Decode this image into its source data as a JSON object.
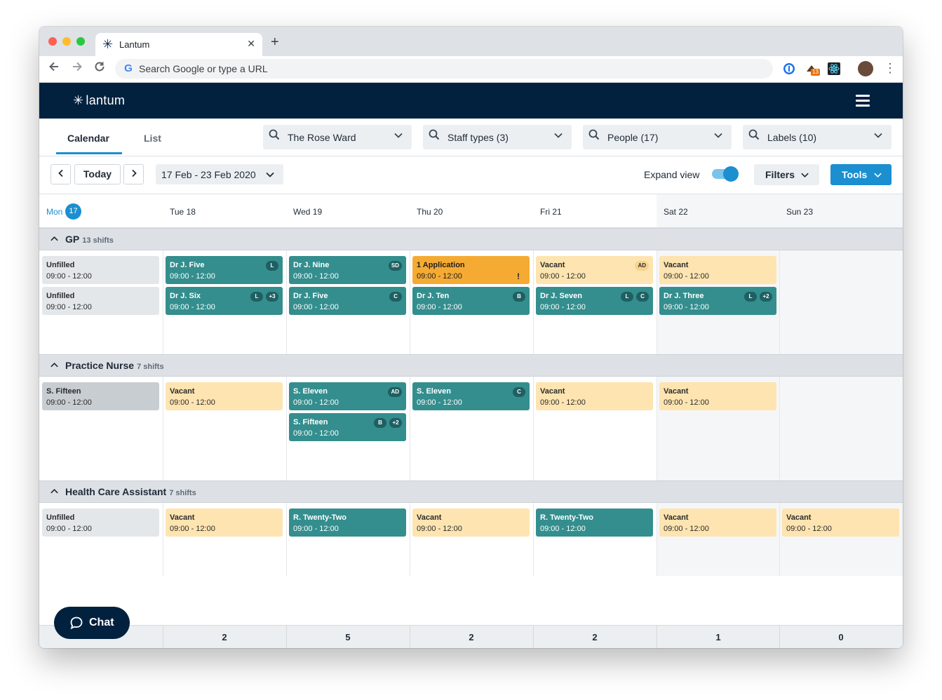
{
  "browser": {
    "tab_title": "Lantum",
    "omnibox_placeholder": "Search Google or type a URL",
    "extension_badge": "13"
  },
  "app": {
    "logo_text": "lantum",
    "view_tabs": [
      "Calendar",
      "List"
    ],
    "active_view": "Calendar",
    "filters": [
      {
        "label": "The Rose Ward"
      },
      {
        "label": "Staff types (3)"
      },
      {
        "label": "People (17)"
      },
      {
        "label": "Labels (10)"
      }
    ],
    "date_controls": {
      "today_label": "Today",
      "range_label": "17 Feb - 23 Feb 2020",
      "expand_view_label": "Expand view",
      "expand_view_on": true,
      "filters_label": "Filters",
      "tools_label": "Tools"
    },
    "days": [
      {
        "label": "Mon",
        "badge": "17",
        "today": true
      },
      {
        "label": "Tue 18"
      },
      {
        "label": "Wed 19"
      },
      {
        "label": "Thu 20"
      },
      {
        "label": "Fri 21"
      },
      {
        "label": "Sat 22",
        "weekend": true
      },
      {
        "label": "Sun 23",
        "weekend": true
      }
    ],
    "sections": [
      {
        "title": "GP",
        "count": "13 shifts",
        "days": [
          [
            {
              "name": "Unfilled",
              "time": "09:00 - 12:00",
              "style": "unfilled",
              "tags": []
            },
            {
              "name": "Unfilled",
              "time": "09:00 - 12:00",
              "style": "unfilled",
              "tags": []
            }
          ],
          [
            {
              "name": "Dr J. Five",
              "time": "09:00 - 12:00",
              "style": "teal",
              "tags": [
                "L"
              ]
            },
            {
              "name": "Dr J. Six",
              "time": "09:00 - 12:00",
              "style": "teal",
              "tags": [
                "L",
                "+3"
              ]
            }
          ],
          [
            {
              "name": "Dr J. Nine",
              "time": "09:00 - 12:00",
              "style": "teal",
              "tags": [
                "SD"
              ]
            },
            {
              "name": "Dr J. Five",
              "time": "09:00 - 12:00",
              "style": "teal",
              "tags": [
                "C"
              ]
            }
          ],
          [
            {
              "name": "1 Application",
              "time": "09:00 - 12:00",
              "style": "application",
              "tags": [],
              "alert": "!"
            },
            {
              "name": "Dr J. Ten",
              "time": "09:00 - 12:00",
              "style": "teal",
              "tags": [
                "B"
              ]
            }
          ],
          [
            {
              "name": "Vacant",
              "time": "09:00 - 12:00",
              "style": "vacant",
              "tags": [
                "AD"
              ]
            },
            {
              "name": "Dr J. Seven",
              "time": "09:00 - 12:00",
              "style": "teal",
              "tags": [
                "L",
                "C"
              ]
            }
          ],
          [
            {
              "name": "Vacant",
              "time": "09:00 - 12:00",
              "style": "vacant",
              "tags": []
            },
            {
              "name": "Dr J. Three",
              "time": "09:00 - 12:00",
              "style": "teal",
              "tags": [
                "L",
                "+2"
              ]
            }
          ],
          []
        ]
      },
      {
        "title": "Practice Nurse",
        "count": "7 shifts",
        "days": [
          [
            {
              "name": "S. Fifteen",
              "time": "09:00 - 12:00",
              "style": "filledgrey",
              "tags": []
            }
          ],
          [
            {
              "name": "Vacant",
              "time": "09:00 - 12:00",
              "style": "vacant",
              "tags": []
            }
          ],
          [
            {
              "name": "S. Eleven",
              "time": "09:00 - 12:00",
              "style": "teal",
              "tags": [
                "AD"
              ]
            },
            {
              "name": "S. Fifteen",
              "time": "09:00 - 12:00",
              "style": "teal",
              "tags": [
                "B",
                "+2"
              ]
            }
          ],
          [
            {
              "name": "S. Eleven",
              "time": "09:00 - 12:00",
              "style": "teal",
              "tags": [
                "C"
              ]
            }
          ],
          [
            {
              "name": "Vacant",
              "time": "09:00 - 12:00",
              "style": "vacant",
              "tags": []
            }
          ],
          [
            {
              "name": "Vacant",
              "time": "09:00 - 12:00",
              "style": "vacant",
              "tags": []
            }
          ],
          []
        ]
      },
      {
        "title": "Health Care Assistant",
        "count": "7 shifts",
        "days": [
          [
            {
              "name": "Unfilled",
              "time": "09:00 - 12:00",
              "style": "unfilled",
              "tags": []
            }
          ],
          [
            {
              "name": "Vacant",
              "time": "09:00 - 12:00",
              "style": "vacant",
              "tags": []
            }
          ],
          [
            {
              "name": "R. Twenty-Two",
              "time": "09:00 - 12:00",
              "style": "teal",
              "tags": []
            }
          ],
          [
            {
              "name": "Vacant",
              "time": "09:00 - 12:00",
              "style": "vacant",
              "tags": []
            }
          ],
          [
            {
              "name": "R. Twenty-Two",
              "time": "09:00 - 12:00",
              "style": "teal",
              "tags": []
            }
          ],
          [
            {
              "name": "Vacant",
              "time": "09:00 - 12:00",
              "style": "vacant",
              "tags": []
            }
          ],
          [
            {
              "name": "Vacant",
              "time": "09:00 - 12:00",
              "style": "vacant",
              "tags": []
            }
          ]
        ]
      }
    ],
    "footer_counts": [
      "",
      "2",
      "5",
      "2",
      "2",
      "1",
      "0"
    ],
    "chat_label": "Chat"
  },
  "colors": {
    "navy": "#02213f",
    "accent_blue": "#1b8fd0",
    "teal": "#348e8e",
    "vacant": "#fde4b0",
    "application": "#f5ab33"
  }
}
